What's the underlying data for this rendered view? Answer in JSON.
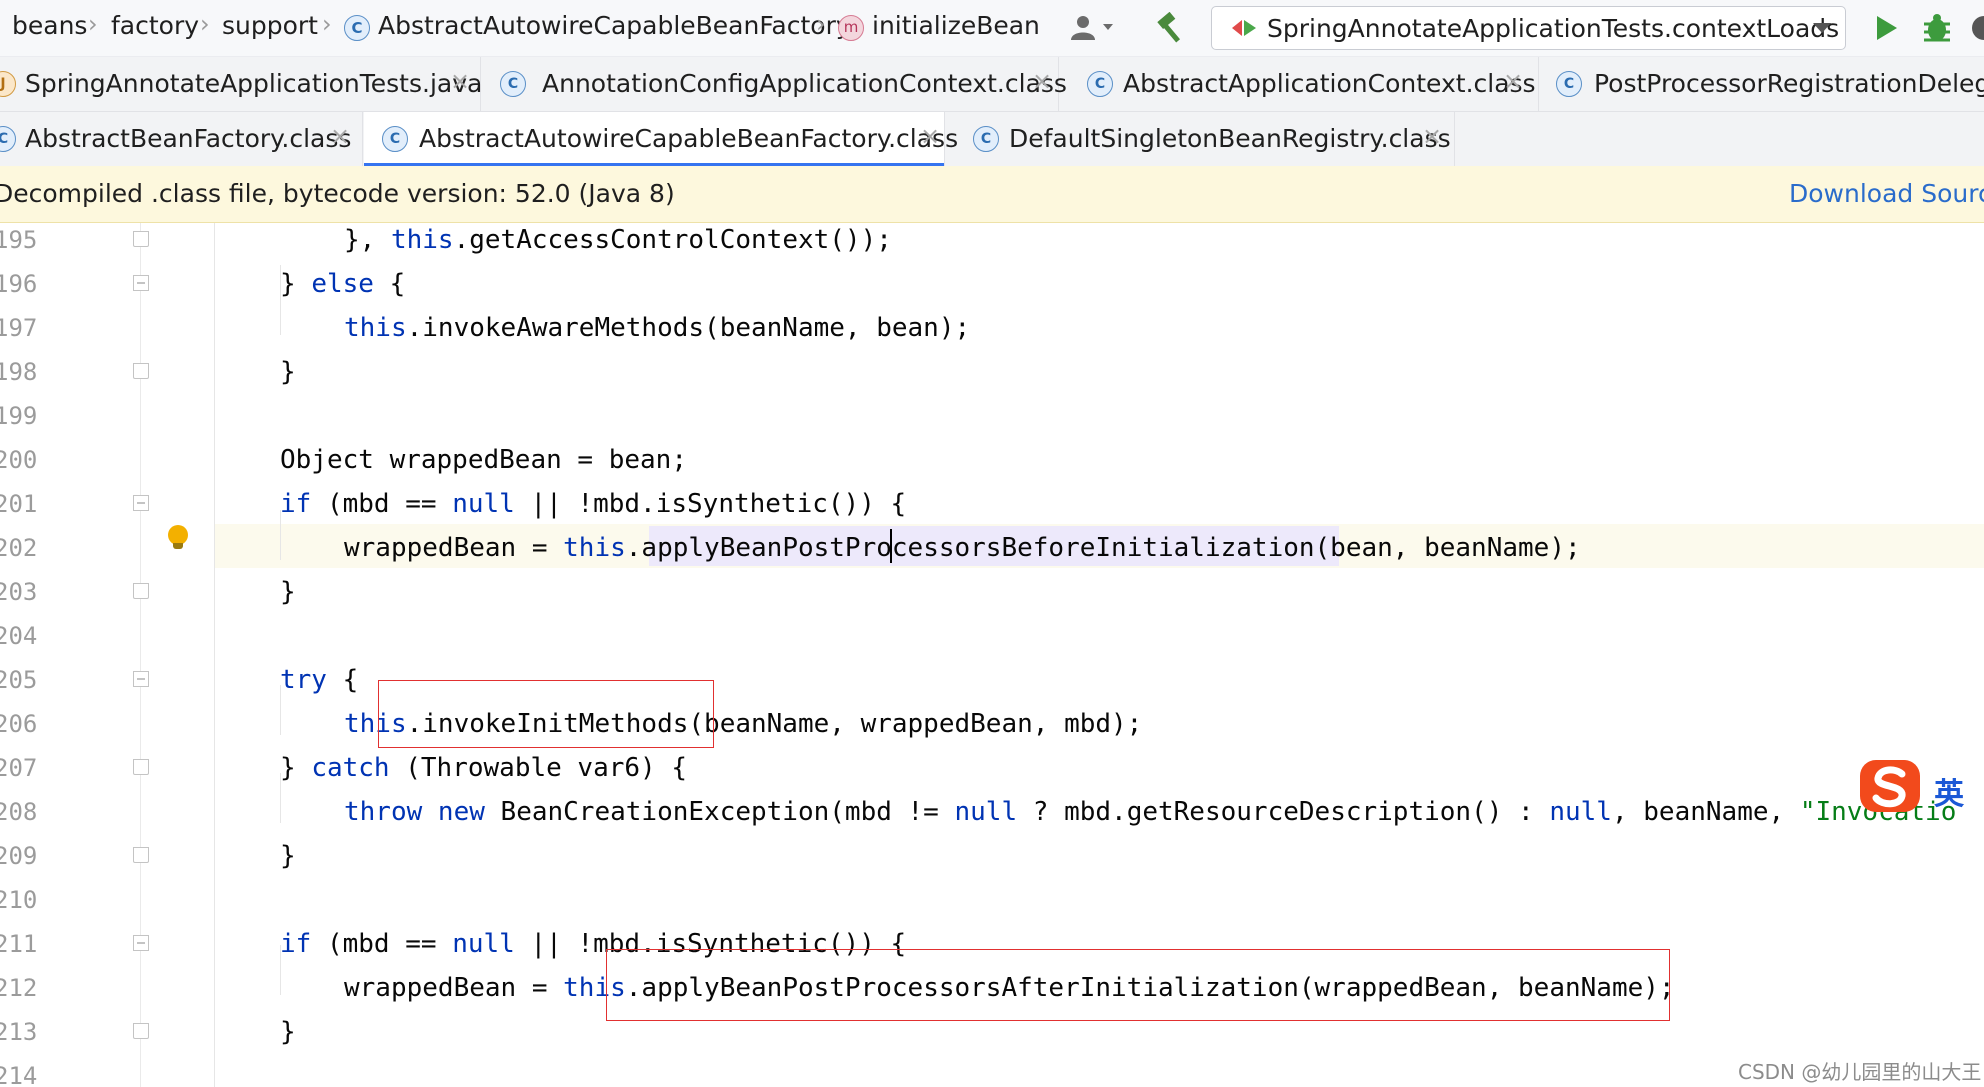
{
  "breadcrumb": {
    "items": [
      "beans",
      "factory",
      "support",
      "AbstractAutowireCapableBeanFactory",
      "initializeBean"
    ]
  },
  "run_config": {
    "label": "SpringAnnotateApplicationTests.contextLoads"
  },
  "tabs_row1": [
    {
      "label": "SpringAnnotateApplicationTests.java"
    },
    {
      "label": "AnnotationConfigApplicationContext.class"
    },
    {
      "label": "AbstractApplicationContext.class"
    },
    {
      "label": "PostProcessorRegistrationDelegat"
    }
  ],
  "tabs_row2": [
    {
      "label": "AbstractBeanFactory.class"
    },
    {
      "label": "AbstractAutowireCapableBeanFactory.class",
      "active": true
    },
    {
      "label": "DefaultSingletonBeanRegistry.class"
    }
  ],
  "banner": {
    "message": "Decompiled .class file, bytecode version: 52.0 (Java 8)",
    "link": "Download Sources"
  },
  "editor": {
    "line_numbers": [
      "195",
      "196",
      "197",
      "198",
      "199",
      "200",
      "201",
      "202",
      "203",
      "204",
      "205",
      "206",
      "207",
      "208",
      "209",
      "210",
      "211",
      "212",
      "213",
      "214"
    ],
    "current_line": "202"
  },
  "ime": {
    "label": "英"
  },
  "watermark": "CSDN @幼儿园里的山大王",
  "colors": {
    "keyword": "#0033b3",
    "string": "#067d17",
    "highlight_box": "#e13030",
    "link": "#2a6ccb",
    "banner_bg": "#fdf8dd"
  }
}
